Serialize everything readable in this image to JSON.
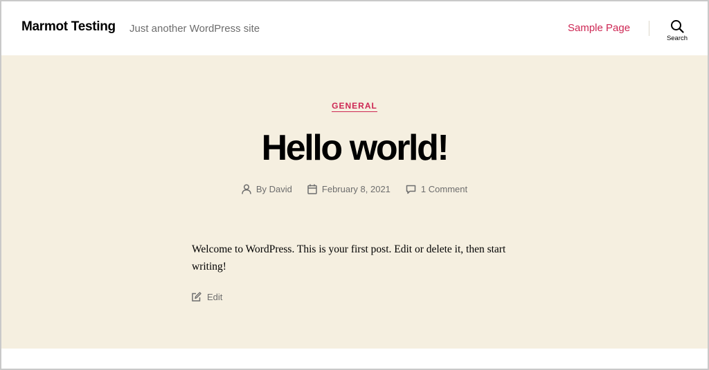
{
  "header": {
    "site_title": "Marmot Testing",
    "site_description": "Just another WordPress site",
    "nav_items": [
      {
        "label": "Sample Page"
      }
    ],
    "search_label": "Search"
  },
  "post": {
    "category": "GENERAL",
    "title": "Hello world!",
    "author": "By David",
    "date": "February 8, 2021",
    "comments": "1 Comment",
    "content": "Welcome to WordPress. This is your first post. Edit or delete it, then start writing!",
    "edit_label": "Edit"
  },
  "colors": {
    "accent": "#cd2653",
    "hero_background": "#f5efe0",
    "meta_text": "#6d6d6d"
  },
  "icons": {
    "search": "search-icon",
    "author": "user-icon",
    "date": "calendar-icon",
    "comments": "comment-icon",
    "edit": "edit-icon"
  }
}
